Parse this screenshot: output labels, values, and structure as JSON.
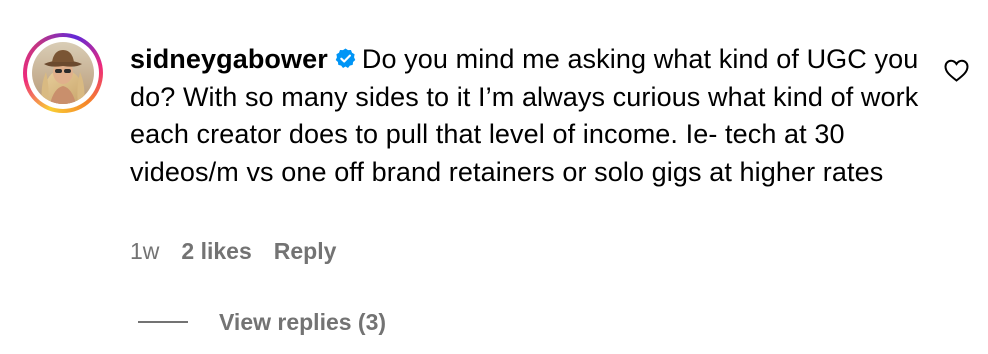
{
  "comment": {
    "username": "sidneygabower",
    "verified_icon": "verified-badge-icon",
    "text": "Do you mind me asking what kind of UGC you do? With so many sides to it I’m always curious what kind of work each creator does to pull that level of income. Ie- tech at 30 videos/m vs one off brand retainers or solo gigs at higher rates",
    "time": "1w",
    "likes": "2 likes",
    "reply_label": "Reply",
    "like_icon": "heart-icon"
  },
  "replies": {
    "label": "View replies (3)"
  },
  "colors": {
    "text": "#000000",
    "muted": "#737373",
    "verified": "#0095f6"
  }
}
